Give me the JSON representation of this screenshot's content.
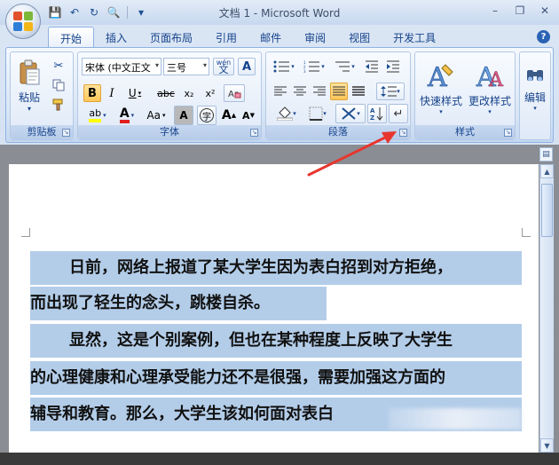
{
  "window": {
    "title": "文档 1 - Microsoft Word"
  },
  "quick_access": {
    "save": "💾",
    "undo": "↶",
    "redo": "↻",
    "print_preview": "🔍",
    "customize": "▾"
  },
  "window_controls": {
    "minimize": "–",
    "restore": "❐",
    "close": "✕"
  },
  "tabs": [
    "开始",
    "插入",
    "页面布局",
    "引用",
    "邮件",
    "审阅",
    "视图",
    "开发工具"
  ],
  "help": "?",
  "ribbon": {
    "clipboard": {
      "paste_label": "粘贴",
      "group_label": "剪贴板"
    },
    "font": {
      "font_name": "宋体 (中文正文",
      "font_size": "三号",
      "phonetic": "wén",
      "bold": "B",
      "italic": "I",
      "underline": "U",
      "strikethrough": "abc",
      "subscript": "x₂",
      "superscript": "x²",
      "case": "Aa",
      "grow": "A",
      "shrink": "A",
      "group_label": "字体"
    },
    "paragraph": {
      "group_label": "段落"
    },
    "styles": {
      "quick_styles": "快速样式",
      "change_styles": "更改样式",
      "group_label": "样式"
    },
    "editing": {
      "label": "编辑"
    }
  },
  "document": {
    "lines": [
      "日前，网络上报道了某大学生因为表白招到对方拒绝，",
      "而出现了轻生的念头，跳楼自杀。",
      "显然，这是个别案例，但也在某种程度上反映了大学生",
      "的心理健康和心理承受能力还不是很强，需要加强这方面的",
      "辅导和教育。那么，大学生该如何面对表白"
    ]
  },
  "colors": {
    "ribbon_border": "#8db2e3",
    "selection": "#b3cde9",
    "arrow": "#e8352e",
    "highlight_button": "#ffc65a"
  }
}
